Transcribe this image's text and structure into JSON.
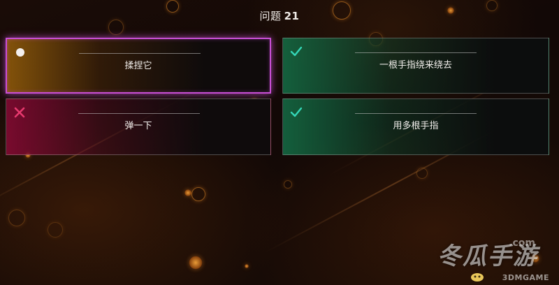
{
  "question": {
    "prefix": "问题",
    "number": "21"
  },
  "answers": [
    {
      "label": "揉捏它",
      "state": "selected",
      "icon": "dot-icon",
      "color": "#c94fd6"
    },
    {
      "label": "一根手指绕来绕去",
      "state": "correct",
      "icon": "check-icon",
      "color": "#34d6b7"
    },
    {
      "label": "弹一下",
      "state": "wrong",
      "icon": "cross-icon",
      "color": "#e8396f"
    },
    {
      "label": "用多根手指",
      "state": "correct",
      "icon": "check-icon",
      "color": "#34d6b7"
    }
  ],
  "watermark": {
    "main": "冬瓜手游",
    "domain": ".com",
    "sub": "3DMGAME"
  }
}
